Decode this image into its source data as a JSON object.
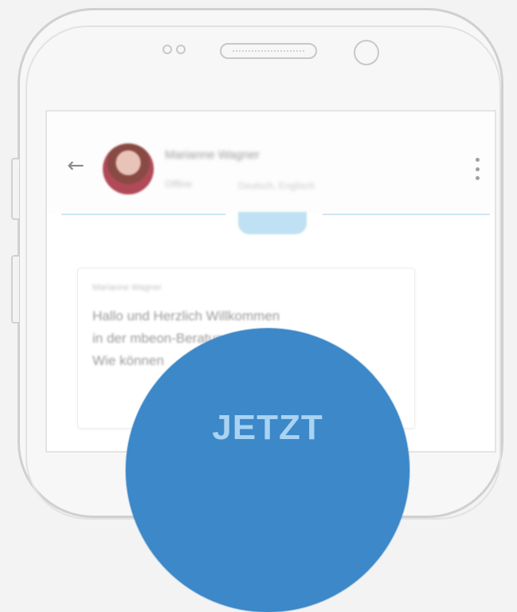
{
  "chat": {
    "contact_name": "Marianne Wagner",
    "status": "Offline",
    "language": "Deutsch, Englisch",
    "message_sender": "Marianne Wagner",
    "message_lines": [
      "Hallo und Herzlich Willkommen",
      "in der mbeon-Beratung!",
      "Wie können"
    ]
  },
  "cta": {
    "label": "JETZT"
  },
  "colors": {
    "accent": "#3c88c8",
    "cta_text": "#a9d3f2",
    "divider": "#cfe6f4"
  }
}
